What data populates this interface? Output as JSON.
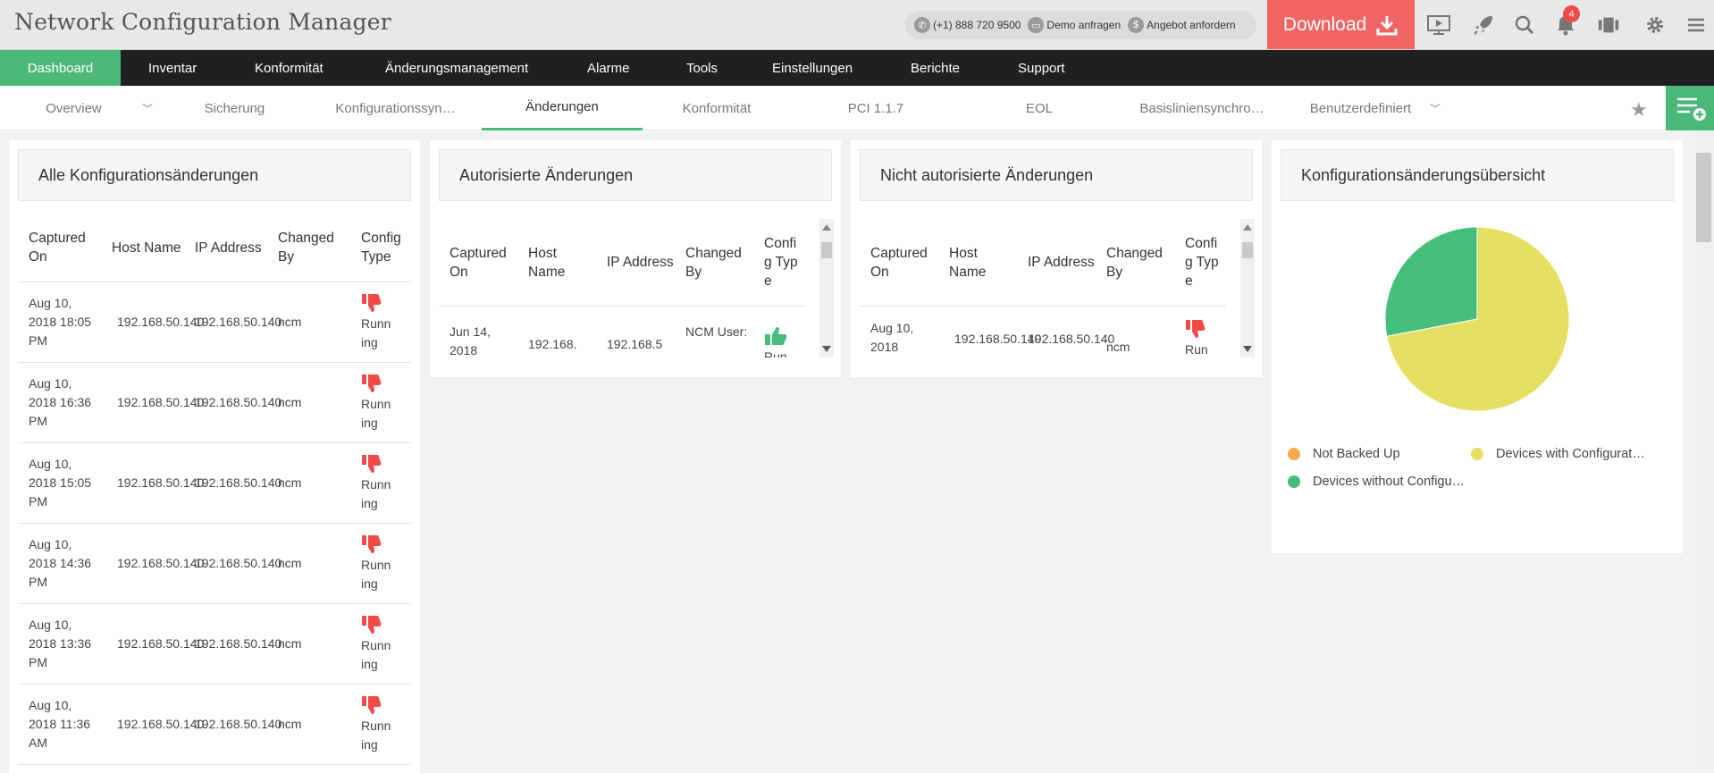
{
  "app": {
    "title": "Network Configuration Manager"
  },
  "contact": {
    "phone": "(+1) 888 720 9500",
    "demo": "Demo anfragen",
    "quote": "Angebot anfordern"
  },
  "download": {
    "label": "Download"
  },
  "notifications": {
    "count": "4"
  },
  "main_nav": [
    "Dashboard",
    "Inventar",
    "Konformität",
    "Änderungsmanagement",
    "Alarme",
    "Tools",
    "Einstellungen",
    "Berichte",
    "Support"
  ],
  "sub_nav": [
    "Overview",
    "Sicherung",
    "Konfigurationssyn…",
    "Änderungen",
    "Konformität",
    "PCI 1.1.7",
    "EOL",
    "Basisliniensynchro…",
    "Benutzerdefiniert"
  ],
  "widgets": {
    "all": {
      "title": "Alle Konfigurationsänderungen",
      "headers": [
        "Captured On",
        "Host Name",
        "IP Address",
        "Changed By",
        "Config Type"
      ],
      "rows": [
        {
          "date": "Aug 10, 2018 18:05 PM",
          "host": "192.168.50.140",
          "ip": "192.168.50.140",
          "by": "ncm",
          "type": "Running"
        },
        {
          "date": "Aug 10, 2018 16:36 PM",
          "host": "192.168.50.140",
          "ip": "192.168.50.140",
          "by": "ncm",
          "type": "Running"
        },
        {
          "date": "Aug 10, 2018 15:05 PM",
          "host": "192.168.50.140",
          "ip": "192.168.50.140",
          "by": "ncm",
          "type": "Running"
        },
        {
          "date": "Aug 10, 2018 14:36 PM",
          "host": "192.168.50.140",
          "ip": "192.168.50.140",
          "by": "ncm",
          "type": "Running"
        },
        {
          "date": "Aug 10, 2018 13:36 PM",
          "host": "192.168.50.140",
          "ip": "192.168.50.140",
          "by": "ncm",
          "type": "Running"
        },
        {
          "date": "Aug 10, 2018 11:36 AM",
          "host": "192.168.50.140",
          "ip": "192.168.50.140",
          "by": "ncm",
          "type": "Running"
        }
      ]
    },
    "auth": {
      "title": "Autorisierte Änderungen",
      "headers": [
        "Captured On",
        "Host Name",
        "IP Address",
        "Changed By",
        "Config Type"
      ],
      "rows": [
        {
          "date": "Jun 14, 2018",
          "host": "192.168.",
          "ip": "192.168.5",
          "by": "NCM User:",
          "type": "Run"
        }
      ]
    },
    "unauth": {
      "title": "Nicht autorisierte Änderungen",
      "headers": [
        "Captured On",
        "Host Name",
        "IP Address",
        "Changed By",
        "Config Type"
      ],
      "rows": [
        {
          "date": "Aug 10, 2018",
          "host": "192.168.50.140",
          "ip": "192.168.50.140",
          "by": "ncm",
          "type": "Run"
        }
      ]
    },
    "overview": {
      "title": "Konfigurationsänderungsübersicht",
      "legend": [
        "Not Backed Up",
        "Devices with Configurat…",
        "Devices without Configu…"
      ]
    }
  },
  "chart_data": {
    "type": "pie",
    "labels": [
      "Not Backed Up",
      "Devices with Configurat…",
      "Devices without Configu…"
    ],
    "values": [
      0,
      72,
      28
    ],
    "colors": [
      "#f5a84d",
      "#e5e062",
      "#45bd7b"
    ]
  }
}
